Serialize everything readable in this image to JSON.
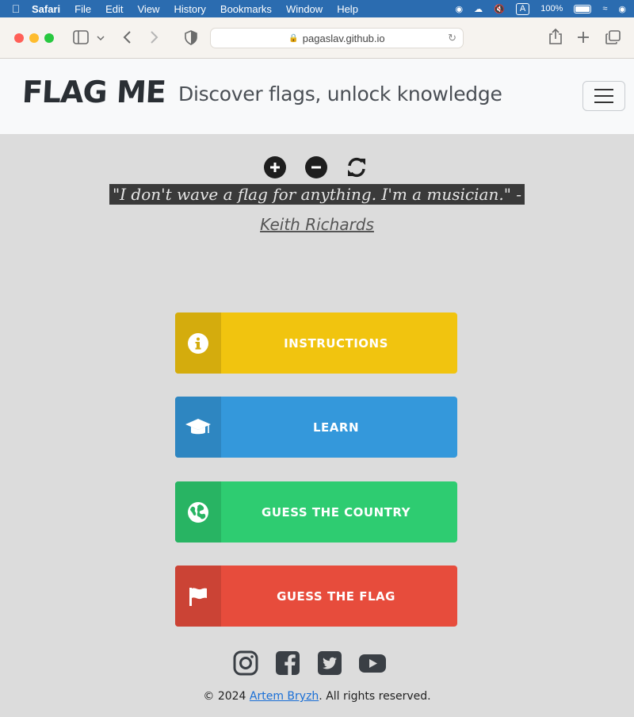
{
  "menubar": {
    "apple": "",
    "items": [
      "Safari",
      "File",
      "Edit",
      "View",
      "History",
      "Bookmarks",
      "Window",
      "Help"
    ],
    "input_source": "A",
    "battery": "100%"
  },
  "browser": {
    "url": "pagaslav.github.io"
  },
  "header": {
    "logo": "FLAG ME",
    "tagline": "Discover flags, unlock knowledge"
  },
  "quote": {
    "text": "\"I don't wave a flag for anything. I'm a musician.\" -",
    "author": "Keith Richards"
  },
  "buttons": {
    "instructions": "INSTRUCTIONS",
    "learn": "LEARN",
    "guess_country": "GUESS THE COUNTRY",
    "guess_flag": "GUESS THE FLAG"
  },
  "footer": {
    "prefix": "© 2024 ",
    "author": "Artem Bryzh",
    "suffix": ". All rights reserved."
  },
  "colors": {
    "instructions": "#f1c40f",
    "learn": "#3498db",
    "guess_country": "#2ecc71",
    "guess_flag": "#e74c3c",
    "page_bg": "#dcdcdc"
  }
}
